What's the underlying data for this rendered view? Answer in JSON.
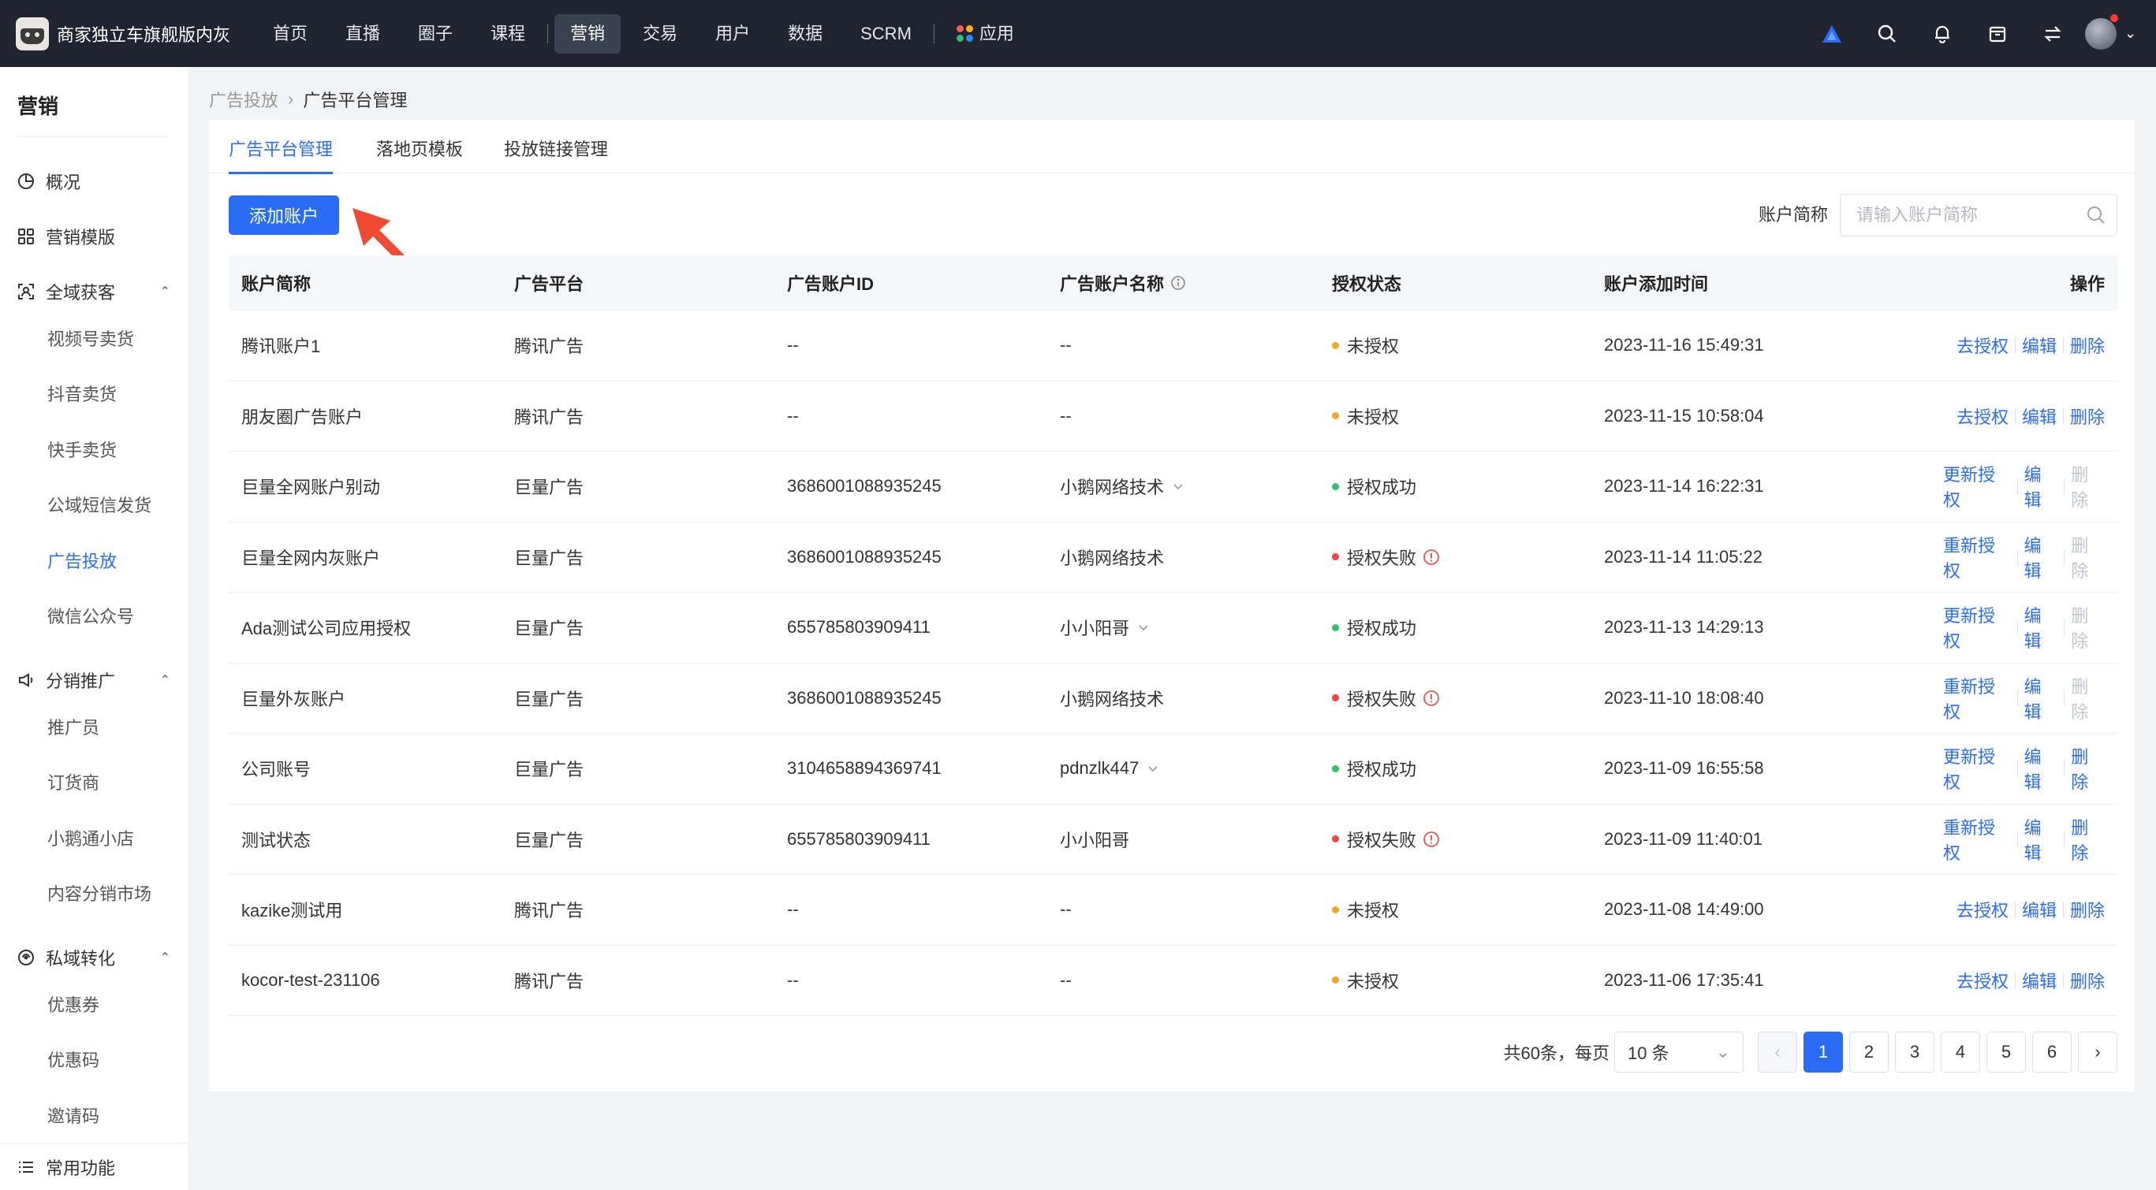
{
  "topbar": {
    "brand": "商家独立车旗舰版内灰",
    "nav": [
      "首页",
      "直播",
      "圈子",
      "课程",
      "营销",
      "交易",
      "用户",
      "数据",
      "SCRM"
    ],
    "active_nav": "营销",
    "app_label": "应用"
  },
  "sidebar": {
    "title": "营销",
    "groups": [
      {
        "label": "概况"
      },
      {
        "label": "营销模版"
      },
      {
        "label": "全域获客",
        "subs": [
          "视频号卖货",
          "抖音卖货",
          "快手卖货",
          "公域短信发货",
          "广告投放",
          "微信公众号"
        ]
      },
      {
        "label": "分销推广",
        "subs": [
          "推广员",
          "订货商",
          "小鹅通小店",
          "内容分销市场"
        ]
      },
      {
        "label": "私域转化",
        "subs": [
          "优惠券",
          "优惠码",
          "邀请码"
        ]
      }
    ],
    "active_sub": "广告投放",
    "footer": "常用功能"
  },
  "breadcrumb": {
    "parent": "广告投放",
    "current": "广告平台管理"
  },
  "tabs": [
    "广告平台管理",
    "落地页模板",
    "投放链接管理"
  ],
  "toolbar": {
    "add_label": "添加账户",
    "filter_label": "账户简称",
    "search_placeholder": "请输入账户简称"
  },
  "table": {
    "columns": [
      "账户简称",
      "广告平台",
      "广告账户ID",
      "广告账户名称",
      "授权状态",
      "账户添加时间",
      "操作"
    ],
    "rows": [
      {
        "name": "腾讯账户1",
        "platform": "腾讯广告",
        "account_id": "--",
        "account_name": "--",
        "has_caret": false,
        "status": "未授权",
        "status_type": "pending",
        "time": "2023-11-16 15:49:31",
        "ops": [
          "去授权",
          "编辑",
          "删除"
        ],
        "delete_disabled": false
      },
      {
        "name": "朋友圈广告账户",
        "platform": "腾讯广告",
        "account_id": "--",
        "account_name": "--",
        "has_caret": false,
        "status": "未授权",
        "status_type": "pending",
        "time": "2023-11-15 10:58:04",
        "ops": [
          "去授权",
          "编辑",
          "删除"
        ],
        "delete_disabled": false
      },
      {
        "name": "巨量全网账户别动",
        "platform": "巨量广告",
        "account_id": "3686001088935245",
        "account_name": "小鹅网络技术",
        "has_caret": true,
        "status": "授权成功",
        "status_type": "success",
        "time": "2023-11-14 16:22:31",
        "ops": [
          "更新授权",
          "编辑",
          "删除"
        ],
        "delete_disabled": true
      },
      {
        "name": "巨量全网内灰账户",
        "platform": "巨量广告",
        "account_id": "3686001088935245",
        "account_name": "小鹅网络技术",
        "has_caret": false,
        "status": "授权失败",
        "status_type": "fail",
        "time": "2023-11-14 11:05:22",
        "ops": [
          "重新授权",
          "编辑",
          "删除"
        ],
        "delete_disabled": true
      },
      {
        "name": "Ada测试公司应用授权",
        "platform": "巨量广告",
        "account_id": "655785803909411",
        "account_name": "小小阳哥",
        "has_caret": true,
        "status": "授权成功",
        "status_type": "success",
        "time": "2023-11-13 14:29:13",
        "ops": [
          "更新授权",
          "编辑",
          "删除"
        ],
        "delete_disabled": true
      },
      {
        "name": "巨量外灰账户",
        "platform": "巨量广告",
        "account_id": "3686001088935245",
        "account_name": "小鹅网络技术",
        "has_caret": false,
        "status": "授权失败",
        "status_type": "fail",
        "time": "2023-11-10 18:08:40",
        "ops": [
          "重新授权",
          "编辑",
          "删除"
        ],
        "delete_disabled": true
      },
      {
        "name": "公司账号",
        "platform": "巨量广告",
        "account_id": "3104658894369741",
        "account_name": "pdnzlk447",
        "has_caret": true,
        "status": "授权成功",
        "status_type": "success",
        "time": "2023-11-09 16:55:58",
        "ops": [
          "更新授权",
          "编辑",
          "删除"
        ],
        "delete_disabled": false
      },
      {
        "name": "测试状态",
        "platform": "巨量广告",
        "account_id": "655785803909411",
        "account_name": "小小阳哥",
        "has_caret": false,
        "status": "授权失败",
        "status_type": "fail",
        "time": "2023-11-09 11:40:01",
        "ops": [
          "重新授权",
          "编辑",
          "删除"
        ],
        "delete_disabled": false
      },
      {
        "name": "kazike测试用",
        "platform": "腾讯广告",
        "account_id": "--",
        "account_name": "--",
        "has_caret": false,
        "status": "未授权",
        "status_type": "pending",
        "time": "2023-11-08 14:49:00",
        "ops": [
          "去授权",
          "编辑",
          "删除"
        ],
        "delete_disabled": false
      },
      {
        "name": "kocor-test-231106",
        "platform": "腾讯广告",
        "account_id": "--",
        "account_name": "--",
        "has_caret": false,
        "status": "未授权",
        "status_type": "pending",
        "time": "2023-11-06 17:35:41",
        "ops": [
          "去授权",
          "编辑",
          "删除"
        ],
        "delete_disabled": false
      }
    ]
  },
  "pagination": {
    "total_text": "共60条，每页",
    "page_size": "10 条",
    "pages": [
      "1",
      "2",
      "3",
      "4",
      "5",
      "6"
    ],
    "current": "1"
  },
  "colors": {
    "accent": "#2a6df4",
    "pending": "#f5a623",
    "success": "#2ec26a",
    "fail": "#f0443d",
    "arrow": "#ef4a32"
  }
}
